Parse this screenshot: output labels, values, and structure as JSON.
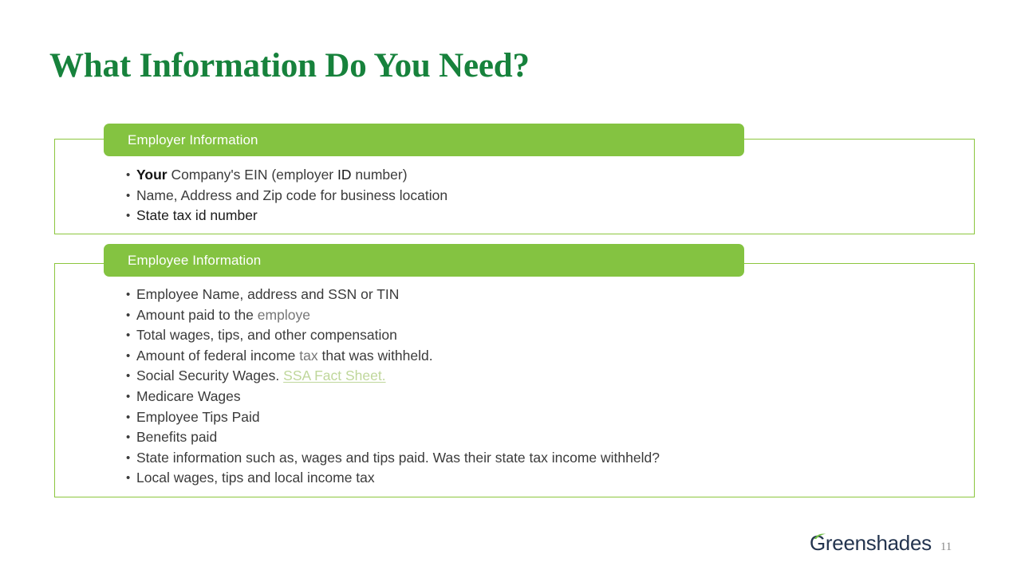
{
  "slide": {
    "title": "What Information Do You Need?",
    "title_color": "#17823C",
    "accent_green": "#84C341",
    "border_green": "#8CC63E",
    "body_text_color": "#3B3B3B",
    "link_color": "#BFD79B"
  },
  "sections": [
    {
      "header": "Employer Information",
      "bullets": [
        {
          "runs": [
            {
              "text": "Your",
              "style": "strong"
            },
            {
              "text": " Company's EIN (employer ",
              "style": "normal"
            },
            {
              "text": "ID",
              "style": "dark"
            },
            {
              "text": " number)",
              "style": "normal"
            }
          ],
          "plain": "Your Company's EIN (employer ID number)"
        },
        {
          "runs": [
            {
              "text": "Name, Address and Zip code for business location",
              "style": "normal"
            }
          ],
          "plain": "Name, Address and Zip code for business location"
        },
        {
          "runs": [
            {
              "text": "State tax id number",
              "style": "dark"
            }
          ],
          "plain": "State tax id number"
        }
      ]
    },
    {
      "header": "Employee Information",
      "bullets": [
        {
          "runs": [
            {
              "text": "Employee Name, address and SSN or TIN",
              "style": "normal"
            }
          ],
          "plain": "Employee Name, address and SSN or TIN"
        },
        {
          "runs": [
            {
              "text": "Amount paid to the ",
              "style": "normal"
            },
            {
              "text": "employe",
              "style": "muted"
            }
          ],
          "plain": "Amount paid to the employe"
        },
        {
          "runs": [
            {
              "text": "Total wages, tips, and other compensation",
              "style": "normal"
            }
          ],
          "plain": "Total wages, tips, and other compensation"
        },
        {
          "runs": [
            {
              "text": "Amount of federal income ",
              "style": "normal"
            },
            {
              "text": "tax",
              "style": "muted"
            },
            {
              "text": " that was withheld.",
              "style": "normal"
            }
          ],
          "plain": "Amount of federal income tax that was withheld."
        },
        {
          "runs": [
            {
              "text": "Social Security Wages. ",
              "style": "normal"
            },
            {
              "text": "SSA Fact Sheet.",
              "style": "link"
            }
          ],
          "plain": "Social Security Wages. SSA Fact Sheet."
        },
        {
          "runs": [
            {
              "text": "Medicare Wages",
              "style": "normal"
            }
          ],
          "plain": "Medicare Wages"
        },
        {
          "runs": [
            {
              "text": "Employee Tips Paid",
              "style": "normal"
            }
          ],
          "plain": "Employee Tips Paid"
        },
        {
          "runs": [
            {
              "text": "Benefits paid",
              "style": "normal"
            }
          ],
          "plain": "Benefits paid"
        },
        {
          "runs": [
            {
              "text": "State information such as, wages and tips paid. Was their state tax income withheld?",
              "style": "normal"
            }
          ],
          "plain": "State information such as, wages and tips paid. Was their state tax income withheld?"
        },
        {
          "runs": [
            {
              "text": "Local wages, tips and local income tax",
              "style": "normal"
            }
          ],
          "plain": "Local wages, tips and local income tax"
        }
      ]
    }
  ],
  "footer": {
    "logo_text": "Greenshades",
    "logo_color": "#23344F",
    "logo_accent": "#6FBE44",
    "page_number": "11"
  }
}
